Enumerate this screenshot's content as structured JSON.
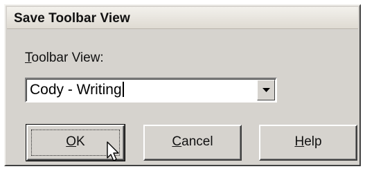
{
  "dialog": {
    "title": "Save Toolbar View"
  },
  "field": {
    "label_accel": "T",
    "label_rest": "oolbar View:",
    "value": "Cody - Writing"
  },
  "buttons": {
    "ok": {
      "accel": "O",
      "rest": "K"
    },
    "cancel": {
      "accel": "C",
      "rest": "ancel"
    },
    "help": {
      "accel": "H",
      "rest": "elp"
    }
  },
  "icons": {
    "dropdown": "chevron-down-icon",
    "cursor": "mouse-pointer-icon"
  },
  "colors": {
    "dialog_bg": "#d6d3ce",
    "title_bg": "#e8e5de"
  }
}
